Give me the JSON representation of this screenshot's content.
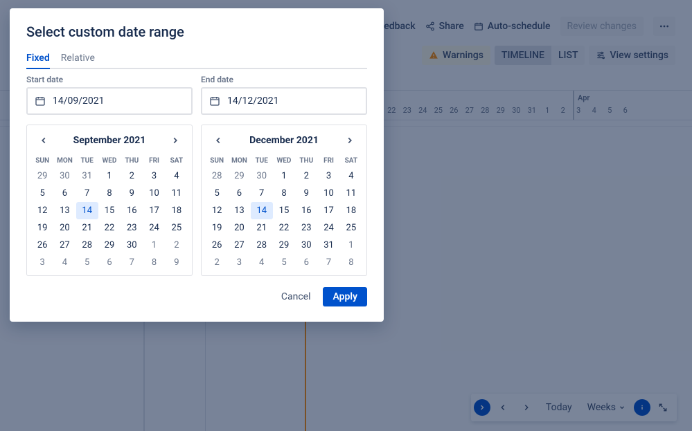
{
  "modal": {
    "title": "Select custom date range",
    "tabs": {
      "fixed": "Fixed",
      "relative": "Relative"
    },
    "start": {
      "label": "Start date",
      "value": "14/09/2021"
    },
    "end": {
      "label": "End date",
      "value": "14/12/2021"
    },
    "days_of_week": [
      "SUN",
      "MON",
      "TUE",
      "WED",
      "THU",
      "FRI",
      "SAT"
    ],
    "cal_start": {
      "title": "September 2021",
      "selected_index": 16,
      "cells": [
        {
          "n": 29,
          "off": true
        },
        {
          "n": 30,
          "off": true
        },
        {
          "n": 31,
          "off": true
        },
        {
          "n": 1
        },
        {
          "n": 2
        },
        {
          "n": 3
        },
        {
          "n": 4
        },
        {
          "n": 5
        },
        {
          "n": 6
        },
        {
          "n": 7
        },
        {
          "n": 8
        },
        {
          "n": 9
        },
        {
          "n": 10
        },
        {
          "n": 11
        },
        {
          "n": 12
        },
        {
          "n": 13
        },
        {
          "n": 14
        },
        {
          "n": 15
        },
        {
          "n": 16
        },
        {
          "n": 17
        },
        {
          "n": 18
        },
        {
          "n": 19
        },
        {
          "n": 20
        },
        {
          "n": 21
        },
        {
          "n": 22
        },
        {
          "n": 23
        },
        {
          "n": 24
        },
        {
          "n": 25
        },
        {
          "n": 26
        },
        {
          "n": 27
        },
        {
          "n": 28
        },
        {
          "n": 29
        },
        {
          "n": 30
        },
        {
          "n": 1,
          "off": true
        },
        {
          "n": 2,
          "off": true
        },
        {
          "n": 3,
          "off": true
        },
        {
          "n": 4,
          "off": true
        },
        {
          "n": 5,
          "off": true
        },
        {
          "n": 6,
          "off": true
        },
        {
          "n": 7,
          "off": true
        },
        {
          "n": 8,
          "off": true
        },
        {
          "n": 9,
          "off": true
        }
      ]
    },
    "cal_end": {
      "title": "December 2021",
      "selected_index": 16,
      "cells": [
        {
          "n": 28,
          "off": true
        },
        {
          "n": 29,
          "off": true
        },
        {
          "n": 30,
          "off": true
        },
        {
          "n": 1
        },
        {
          "n": 2
        },
        {
          "n": 3
        },
        {
          "n": 4
        },
        {
          "n": 5
        },
        {
          "n": 6
        },
        {
          "n": 7
        },
        {
          "n": 8
        },
        {
          "n": 9
        },
        {
          "n": 10
        },
        {
          "n": 11
        },
        {
          "n": 12
        },
        {
          "n": 13
        },
        {
          "n": 14
        },
        {
          "n": 15
        },
        {
          "n": 16
        },
        {
          "n": 17
        },
        {
          "n": 18
        },
        {
          "n": 19
        },
        {
          "n": 20
        },
        {
          "n": 21
        },
        {
          "n": 22
        },
        {
          "n": 23
        },
        {
          "n": 24
        },
        {
          "n": 25
        },
        {
          "n": 26
        },
        {
          "n": 27
        },
        {
          "n": 28
        },
        {
          "n": 29
        },
        {
          "n": 30
        },
        {
          "n": 31
        },
        {
          "n": 1,
          "off": true
        },
        {
          "n": 2,
          "off": true
        },
        {
          "n": 3,
          "off": true
        },
        {
          "n": 4,
          "off": true
        },
        {
          "n": 5,
          "off": true
        },
        {
          "n": 6,
          "off": true
        },
        {
          "n": 7,
          "off": true
        },
        {
          "n": 8,
          "off": true
        }
      ]
    },
    "actions": {
      "cancel": "Cancel",
      "apply": "Apply"
    }
  },
  "toolbar": {
    "give_feedback": "Give feedback",
    "share": "Share",
    "auto_schedule": "Auto-schedule",
    "review_changes": "Review changes",
    "warnings": "Warnings",
    "timeline": "TIMELINE",
    "list": "LIST",
    "view_settings": "View settings"
  },
  "ruler": {
    "month": "Apr",
    "days": [
      22,
      23,
      24,
      25,
      26,
      27,
      28,
      29,
      30,
      31,
      1,
      2,
      3,
      4,
      5,
      6
    ]
  },
  "footer": {
    "today": "Today",
    "weeks": "Weeks"
  }
}
